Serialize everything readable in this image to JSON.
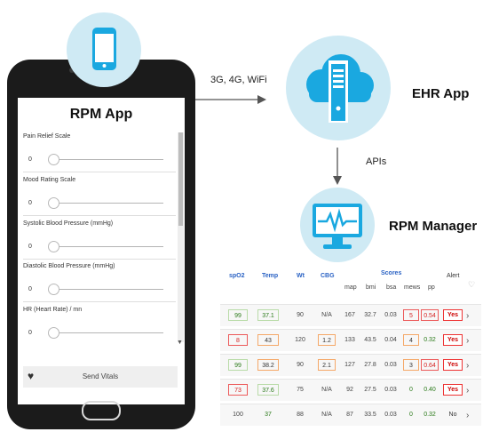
{
  "phone": {
    "app_title": "RPM App",
    "sliders": [
      {
        "label": "Pain Relief Scale",
        "value": "0"
      },
      {
        "label": "Mood Rating Scale",
        "value": "0"
      },
      {
        "label": "Systolic Blood Pressure (mmHg)",
        "value": "0"
      },
      {
        "label": "Diastolic Blood Pressure (mmHg)",
        "value": "0"
      },
      {
        "label": "HR (Heart Rate) / mn",
        "value": "0"
      }
    ],
    "send_button": "Send Vitals",
    "heart_icon": "heart-icon"
  },
  "connection": {
    "label": "3G, 4G, WiFi",
    "apis_label": "APIs"
  },
  "ehr": {
    "label": "EHR App",
    "icon": "cloud-server-icon"
  },
  "rpm_manager": {
    "label": "RPM Manager",
    "icon": "monitor-heartbeat-icon"
  },
  "table": {
    "headers": {
      "spo2": "spO2",
      "temp": "Temp",
      "wt": "Wt",
      "cbg": "CBG",
      "scores": "Scores",
      "map": "map",
      "bmi": "bmi",
      "bsa": "bsa",
      "mews": "mews",
      "pp": "pp",
      "alert": "Alert"
    },
    "rows": [
      {
        "spo2": "99",
        "temp": "37.1",
        "wt": "90",
        "cbg": "N/A",
        "map": "167",
        "bmi": "32.7",
        "bsa": "0.03",
        "mews": "5",
        "pp": "0.54",
        "alert": "Yes"
      },
      {
        "spo2": "8",
        "temp": "43",
        "wt": "120",
        "cbg": "1.2",
        "map": "133",
        "bmi": "43.5",
        "bsa": "0.04",
        "mews": "4",
        "pp": "0.32",
        "alert": "Yes"
      },
      {
        "spo2": "99",
        "temp": "38.2",
        "wt": "90",
        "cbg": "2.1",
        "map": "127",
        "bmi": "27.8",
        "bsa": "0.03",
        "mews": "3",
        "pp": "0.64",
        "alert": "Yes"
      },
      {
        "spo2": "73",
        "temp": "37.6",
        "wt": "75",
        "cbg": "N/A",
        "map": "92",
        "bmi": "27.5",
        "bsa": "0.03",
        "mews": "0",
        "pp": "0.40",
        "alert": "Yes"
      },
      {
        "spo2": "100",
        "temp": "37",
        "wt": "88",
        "cbg": "N/A",
        "map": "87",
        "bmi": "33.5",
        "bsa": "0.03",
        "mews": "0",
        "pp": "0.32",
        "alert": "No"
      }
    ]
  },
  "colors": {
    "icon_bg": "#cfeaf4",
    "icon_blue": "#1aa8e0",
    "header_blue": "#2a62c4",
    "alert_red": "#e33333",
    "ok_green": "#2b7a1a"
  }
}
